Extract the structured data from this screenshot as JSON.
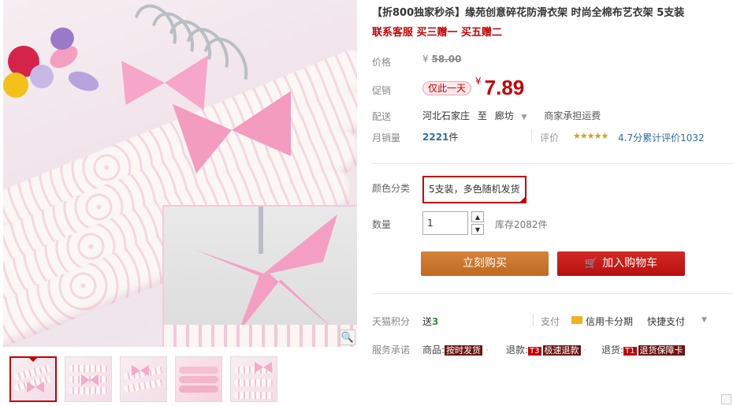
{
  "product": {
    "title": "【折800独家秒杀】缘苑创意碎花防滑衣架 时尚全棉布艺衣架 5支装",
    "subtitle": "联系客服 买三赠一 买五赠二"
  },
  "price": {
    "label": "价格",
    "currency": "¥",
    "original": "58.00"
  },
  "promo": {
    "label": "促销",
    "tag": "仅此一天",
    "currency": "¥",
    "price": "7.89"
  },
  "shipping": {
    "label": "配送",
    "from": "河北石家庄",
    "to_word": "至",
    "destination": "廊坊",
    "fee": "商家承担运费"
  },
  "sales": {
    "label": "月销量",
    "count": "2221",
    "unit": "件",
    "review_label": "评价",
    "stars": "★★★★★",
    "review_text": "4.7分累计评价1032"
  },
  "sku": {
    "label": "颜色分类",
    "selected": "5支装，多色随机发货",
    "check_icon": "check-icon"
  },
  "quantity": {
    "label": "数量",
    "value": "1",
    "up": "▲",
    "down": "▼",
    "stock": "库存2082件"
  },
  "actions": {
    "buy_now": "立刻购买",
    "add_cart": "加入购物车",
    "cart_glyph": "🛒"
  },
  "points": {
    "label": "天猫积分",
    "prefix": "送",
    "value": "3"
  },
  "payment": {
    "label": "支付",
    "credit": "信用卡分期",
    "quick": "快捷支付",
    "caret": "▼"
  },
  "service": {
    "label": "服务承诺",
    "items": [
      {
        "prefix": "商品:",
        "badge": "",
        "tag": "按时发货"
      },
      {
        "prefix": "退款:",
        "badge": "T3",
        "tag": "极速退款"
      },
      {
        "prefix": "退货:",
        "badge": "T1",
        "tag": "退货保障卡"
      }
    ]
  },
  "gallery": {
    "zoom_icon": "🔍",
    "thumb_count": 5
  },
  "colors": {
    "accent_red": "#c40000",
    "buy_orange": "#c9732b",
    "link_blue": "#2e6ea3"
  }
}
